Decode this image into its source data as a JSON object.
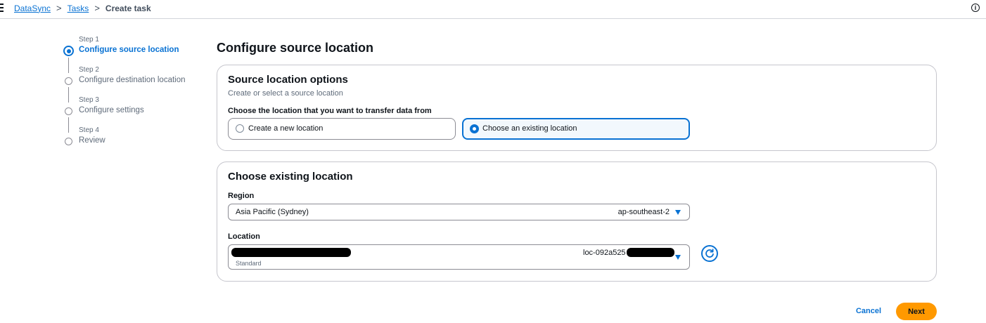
{
  "breadcrumb": {
    "items": [
      {
        "label": "DataSync"
      },
      {
        "label": "Tasks"
      }
    ],
    "current": "Create task",
    "separator": ">"
  },
  "steps": [
    {
      "number": "Step 1",
      "title": "Configure source location",
      "active": true
    },
    {
      "number": "Step 2",
      "title": "Configure destination location",
      "active": false
    },
    {
      "number": "Step 3",
      "title": "Configure settings",
      "active": false
    },
    {
      "number": "Step 4",
      "title": "Review",
      "active": false
    }
  ],
  "page_title": "Configure source location",
  "source_options": {
    "title": "Source location options",
    "description": "Create or select a source location",
    "question": "Choose the location that you want to transfer data from",
    "options": [
      {
        "label": "Create a new location",
        "selected": false
      },
      {
        "label": "Choose an existing location",
        "selected": true
      }
    ]
  },
  "existing_location": {
    "title": "Choose existing location",
    "region_label": "Region",
    "region_value": "Asia Pacific (Sydney)",
    "region_code": "ap-southeast-2",
    "location_label": "Location",
    "location_id_prefix": "loc-092a525",
    "location_secondary": "Standard"
  },
  "actions": {
    "cancel": "Cancel",
    "next": "Next"
  },
  "colors": {
    "accent": "#0972d3",
    "primary_button": "#ff9900",
    "border": "#c6c6cd"
  },
  "icons": [
    "menu-icon",
    "info-icon",
    "caret-down-icon",
    "refresh-icon"
  ]
}
